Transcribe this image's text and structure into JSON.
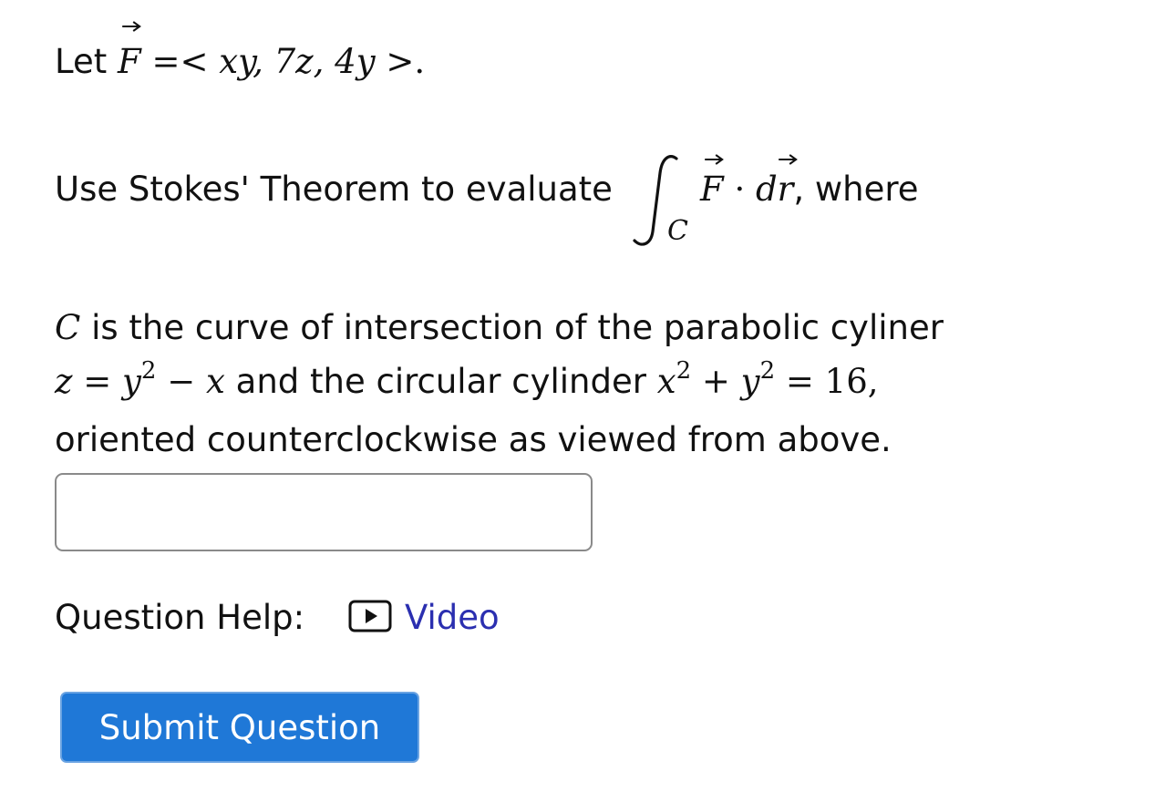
{
  "problem": {
    "let_word": "Let",
    "field_letter": "F",
    "field_equals": "=<",
    "field_components": "xy, 7z, 4y",
    "field_close": ">.",
    "use_stokes_text": "Use Stokes' Theorem to evaluate",
    "integral_subscript": "C",
    "integrand_dot": "·",
    "integrand_d": "d",
    "integrand_r": "r",
    "where_text": ", where",
    "curve_letter": "C",
    "curve_desc_1": "is the curve of intersection of the parabolic cyliner",
    "eq1_lhs": "z = y",
    "eq1_exp": "2",
    "eq1_rhs": "− x",
    "and_text": "and the circular cylinder",
    "eq2_x": "x",
    "eq2_exp1": "2",
    "eq2_plus": "+ y",
    "eq2_exp2": "2",
    "eq2_rhs": "= 16,",
    "curve_desc_3": "oriented counterclockwise as viewed from above."
  },
  "answer": {
    "value": "",
    "placeholder": ""
  },
  "help": {
    "label": "Question Help:",
    "video_label": "Video",
    "video_icon": "play-icon",
    "link_color": "#2b2fb0"
  },
  "submit": {
    "label": "Submit Question",
    "color": "#1f78d7"
  }
}
